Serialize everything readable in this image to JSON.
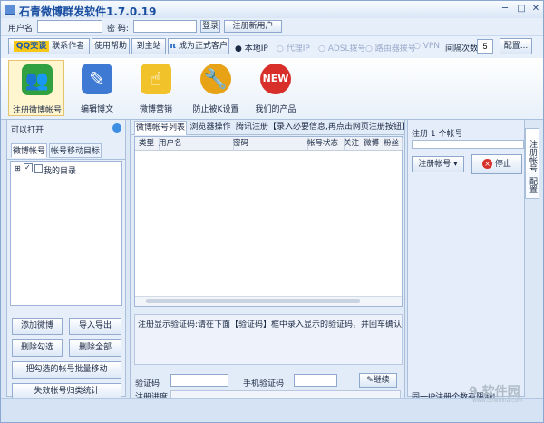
{
  "window": {
    "title": "石青微博群发软件1.7.0.19"
  },
  "login": {
    "username_label": "用户名:",
    "password_label": "密 码:",
    "username_value": "",
    "password_value": "",
    "login_button": "登录",
    "register_button": "注册新用户"
  },
  "toolbar": {
    "qq_label": "QQ交谈",
    "contact_author": "联系作者",
    "help": "使用帮助",
    "home": "到主站",
    "become_customer": "成为正式客户",
    "local_ip": "本地IP",
    "proxy_ip": "代理IP",
    "adsl_dial": "ADSL拨号",
    "router_dial": "路由器拨号",
    "vpn": "VPN",
    "interval_label": "间隔次数",
    "interval_value": "5",
    "config": "配置..."
  },
  "ribbon": {
    "items": [
      {
        "label": "注册微博帐号",
        "icon": "users-icon",
        "color": "#30a040"
      },
      {
        "label": "编辑博文",
        "icon": "edit-icon",
        "color": "#3e7ad4"
      },
      {
        "label": "微博营销",
        "icon": "hand-icon",
        "color": "#f1c22a"
      },
      {
        "label": "防止被K设置",
        "icon": "wrench-icon",
        "color": "#e8a216"
      },
      {
        "label": "我们的产品",
        "icon": "new-badge-icon",
        "color": "#d92f2a"
      }
    ]
  },
  "left_panel": {
    "title": "可以打开",
    "tab_accounts": "微博帐号",
    "tab_move": "帐号移动目标",
    "tree_root": "我的目录",
    "buttons": {
      "add": "添加微博",
      "import_export": "导入导出",
      "delete_checked": "删除勾选",
      "delete_all": "删除全部",
      "batch_move": "把勾选的帐号批量移动",
      "failed_stats": "失效帐号归类统计"
    }
  },
  "center": {
    "tabs": {
      "list": "微博帐号列表",
      "browser": "浏览器操作",
      "tencent": "腾讯注册【录入必要信息,再点击网页注册按钮】"
    },
    "columns": [
      "类型",
      "用户名",
      "密码",
      "帐号状态",
      "关注",
      "微博",
      "粉丝"
    ],
    "message": "注册显示验证码:请在下面【验证码】框中录入显示的验证码，并回车确认",
    "captcha_label": "验证码",
    "phone_captcha_label": "手机验证码",
    "continue_button": "继续",
    "progress_label": "注册进度",
    "captcha_value": "",
    "phone_captcha_value": ""
  },
  "right_panel": {
    "status": "注册 1 个帐号",
    "register_select": "注册帐号",
    "stop_button": "停止",
    "note": "同一IP注册个数有限制!",
    "vertical_tabs": [
      "注册帐号",
      "配置"
    ]
  },
  "watermark": {
    "text": "9 软件园",
    "site": "www.downxia.com"
  }
}
